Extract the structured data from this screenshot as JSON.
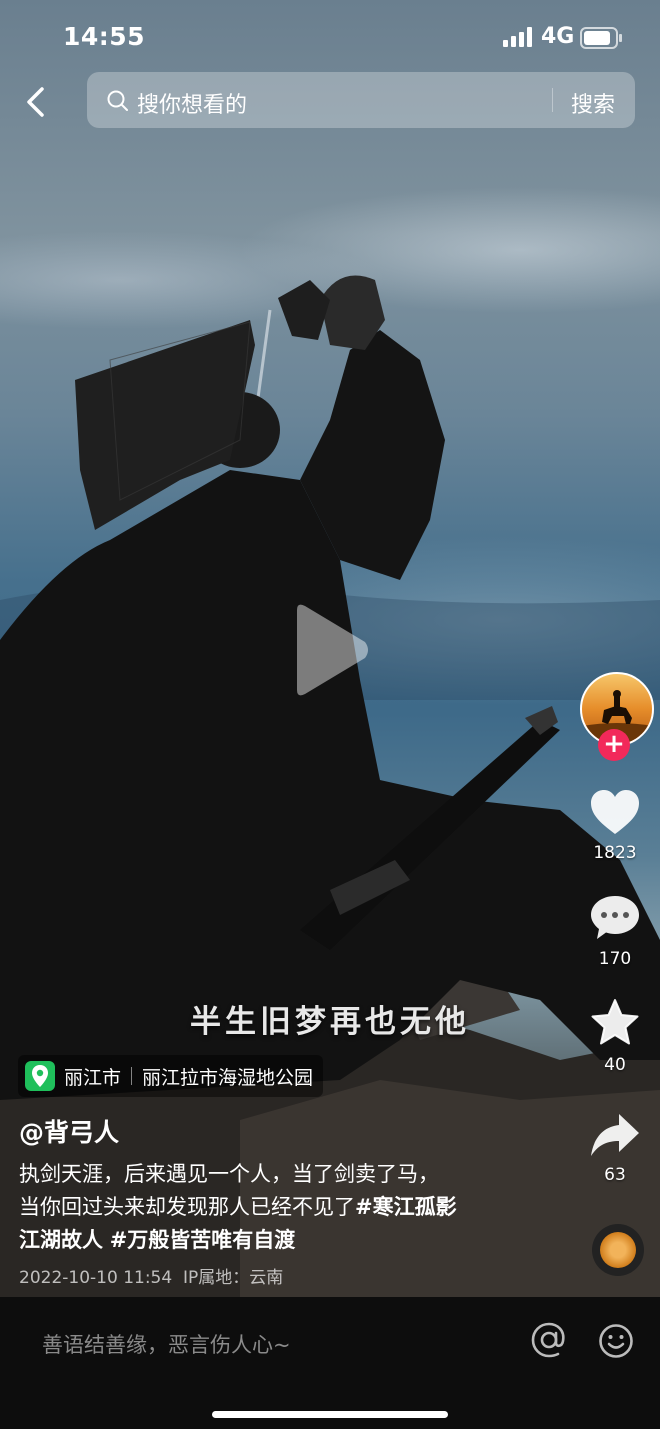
{
  "status_bar": {
    "time": "14:55",
    "network": "4G"
  },
  "search": {
    "placeholder": "搜你想看的",
    "button_label": "搜索"
  },
  "video": {
    "subtitle": "半生旧梦再也无他"
  },
  "actions": {
    "like_count": "1823",
    "comment_count": "170",
    "favorite_count": "40",
    "share_count": "63"
  },
  "location": {
    "city": "丽江市",
    "place": "丽江拉市海湿地公园"
  },
  "post": {
    "author": "@背弓人",
    "description_line1": "执剑天涯，后来遇见一个人，当了剑卖了马，",
    "description_line2_text": "当你回过头来却发现那人已经不见了",
    "tag1": "#寒江孤影",
    "tag2_line3_prefix": "江湖故人",
    "tag3": "#万般皆苦唯有自渡",
    "datetime": "2022-10-10 11:54",
    "ip_location": "IP属地：云南"
  },
  "comment_bar": {
    "placeholder": "善语结善缘，恶言伤人心~"
  },
  "colors": {
    "follow": "#f2295a",
    "location_pin": "#1fbf5b",
    "bar": "#0d0d0d"
  }
}
